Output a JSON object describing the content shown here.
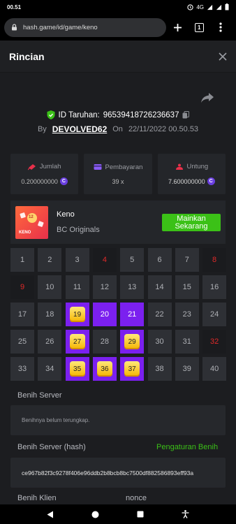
{
  "statusbar": {
    "time": "00.51",
    "network": "4G"
  },
  "browser": {
    "url": "hash.game/id/game/keno",
    "tab_count": "1"
  },
  "header": {
    "title": "Rincian"
  },
  "bet": {
    "id_label": "ID Taruhan:",
    "id": "96539418726236637",
    "by_label": "By",
    "user": "DEVOLVED62",
    "on_label": "On",
    "datetime": "22/11/2022 00.50.53"
  },
  "stats": {
    "amount_label": "Jumlah",
    "amount_value": "0.200000000",
    "payout_label": "Pembayaran",
    "payout_value": "39 x",
    "profit_label": "Untung",
    "profit_value": "7.600000000"
  },
  "game": {
    "name": "Keno",
    "provider": "BC Originals",
    "play_button": "Mainkan Sekarang",
    "thumb_label": "KENO",
    "thumb_ball": "12"
  },
  "board": {
    "cells": [
      {
        "n": "1",
        "s": "none"
      },
      {
        "n": "2",
        "s": "none"
      },
      {
        "n": "3",
        "s": "none"
      },
      {
        "n": "4",
        "s": "miss"
      },
      {
        "n": "5",
        "s": "none"
      },
      {
        "n": "6",
        "s": "none"
      },
      {
        "n": "7",
        "s": "none"
      },
      {
        "n": "8",
        "s": "miss"
      },
      {
        "n": "9",
        "s": "miss"
      },
      {
        "n": "10",
        "s": "none"
      },
      {
        "n": "11",
        "s": "none"
      },
      {
        "n": "12",
        "s": "none"
      },
      {
        "n": "13",
        "s": "none"
      },
      {
        "n": "14",
        "s": "none"
      },
      {
        "n": "15",
        "s": "none"
      },
      {
        "n": "16",
        "s": "none"
      },
      {
        "n": "17",
        "s": "none"
      },
      {
        "n": "18",
        "s": "none"
      },
      {
        "n": "19",
        "s": "hit"
      },
      {
        "n": "20",
        "s": "picked"
      },
      {
        "n": "21",
        "s": "picked"
      },
      {
        "n": "22",
        "s": "none"
      },
      {
        "n": "23",
        "s": "none"
      },
      {
        "n": "24",
        "s": "none"
      },
      {
        "n": "25",
        "s": "none"
      },
      {
        "n": "26",
        "s": "none"
      },
      {
        "n": "27",
        "s": "hit"
      },
      {
        "n": "28",
        "s": "none"
      },
      {
        "n": "29",
        "s": "hit"
      },
      {
        "n": "30",
        "s": "none"
      },
      {
        "n": "31",
        "s": "none"
      },
      {
        "n": "32",
        "s": "miss"
      },
      {
        "n": "33",
        "s": "none"
      },
      {
        "n": "34",
        "s": "none"
      },
      {
        "n": "35",
        "s": "hit"
      },
      {
        "n": "36",
        "s": "hit"
      },
      {
        "n": "37",
        "s": "hit"
      },
      {
        "n": "38",
        "s": "none"
      },
      {
        "n": "39",
        "s": "none"
      },
      {
        "n": "40",
        "s": "none"
      }
    ]
  },
  "seeds": {
    "server_label": "Benih Server",
    "server_value": "Benihnya belum terungkap.",
    "server_hash_label": "Benih Server (hash)",
    "seed_settings_link": "Pengaturan Benih",
    "server_hash_value": "ce967b82f3c9278f406e96ddb2b8bcb8bc7500df882586893eff93a",
    "client_label": "Benih Klien",
    "nonce_label": "nonce"
  },
  "colors": {
    "accent_green": "#3bc117",
    "purple": "#7b20ef",
    "miss_red": "#e02929"
  }
}
